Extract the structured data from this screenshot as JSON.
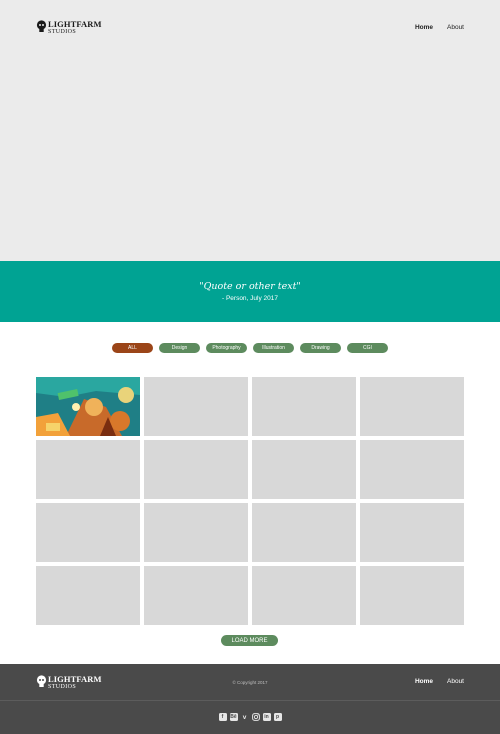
{
  "brand": {
    "line1": "LIGHTFARM",
    "line2": "STUDIOS"
  },
  "nav": {
    "home": "Home",
    "about": "About"
  },
  "quote": {
    "text": "\"Quote or other text\"",
    "attribution": "- Person, July 2017"
  },
  "filters": [
    "ALL",
    "Design",
    "Photography",
    "Illustration",
    "Drawing",
    "CGI"
  ],
  "active_filter": "ALL",
  "gallery": {
    "rows": 4,
    "columns": 4
  },
  "load_more": "LOAD MORE",
  "footer": {
    "copyright": "© Copyright 2017",
    "home": "Home",
    "about": "About",
    "social_icons": [
      "facebook-icon",
      "behance-icon",
      "vimeo-icon",
      "instagram-icon",
      "linkedin-icon",
      "pinterest-icon"
    ]
  },
  "colors": {
    "accent": "#00a393",
    "button": "#5d8b5e",
    "active_button": "#9b4518",
    "footer": "#4a4a4a",
    "hero": "#ebebeb"
  }
}
